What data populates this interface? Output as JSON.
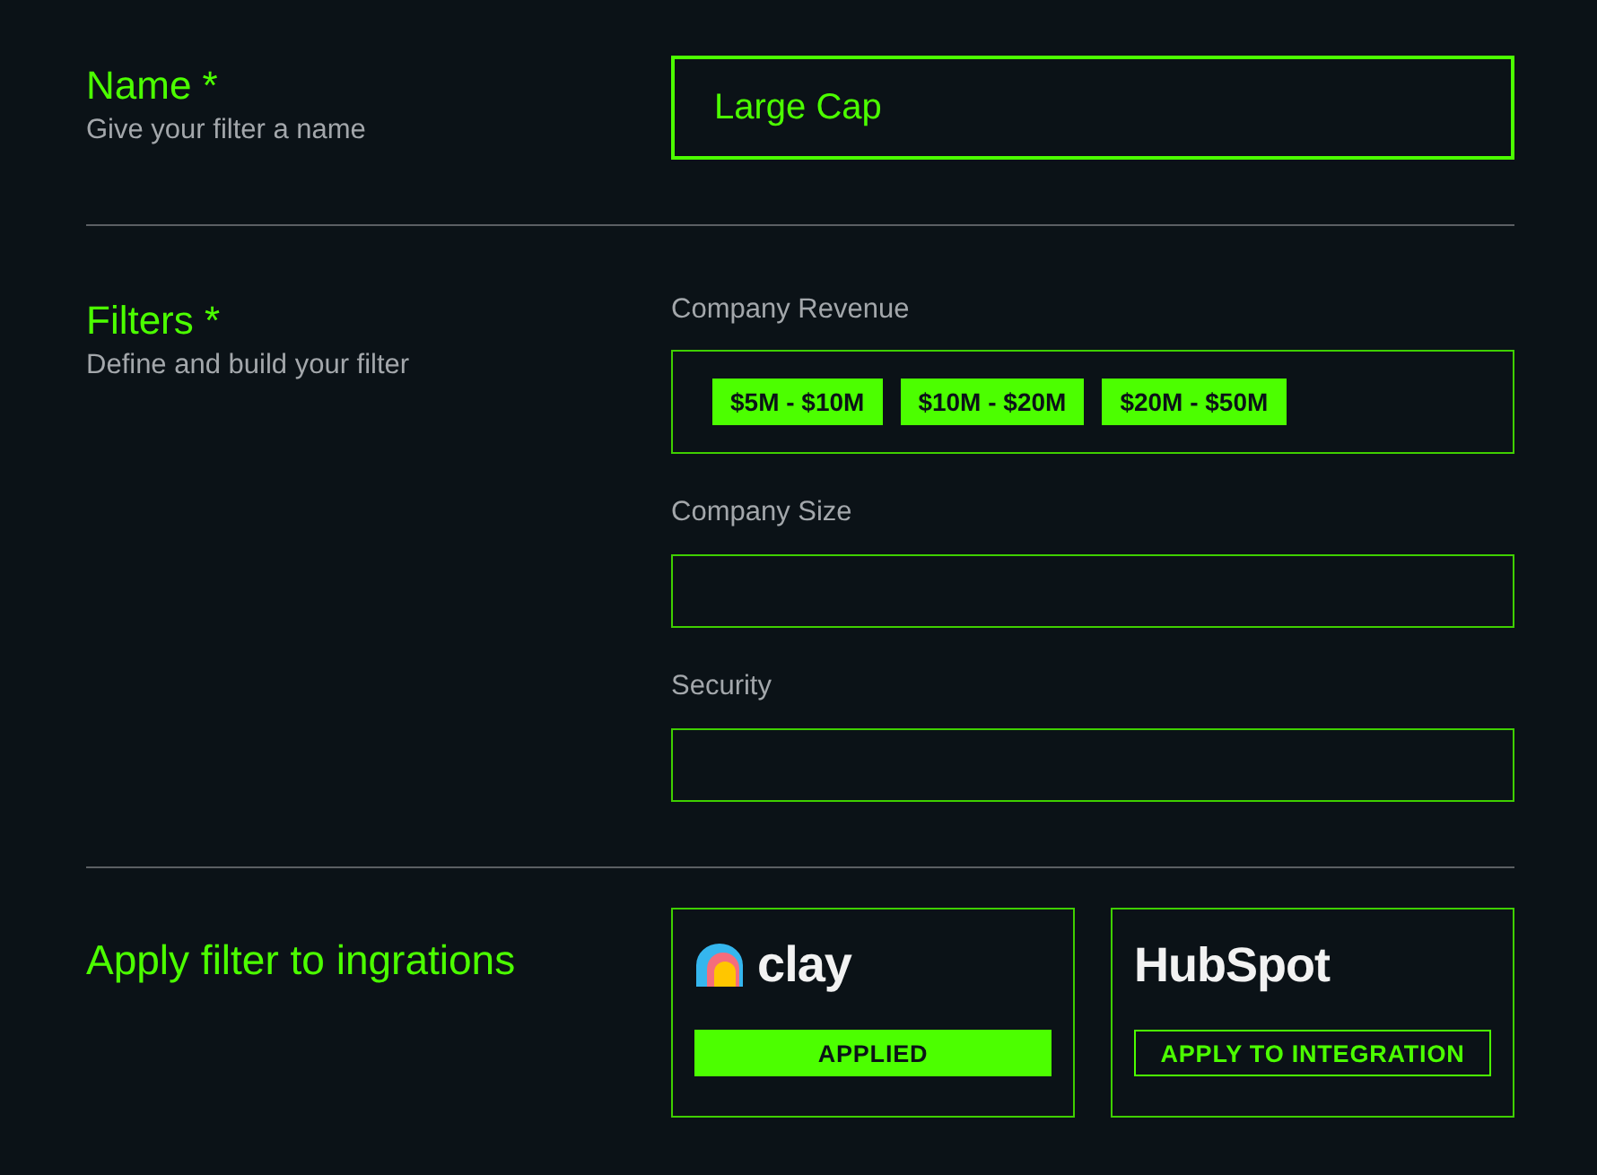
{
  "name_section": {
    "title": "Name *",
    "subtitle": "Give your filter a name",
    "value": "Large Cap"
  },
  "filters_section": {
    "title": "Filters *",
    "subtitle": "Define and build your filter",
    "fields": [
      {
        "label": "Company Revenue",
        "tags": [
          "$5M - $10M",
          "$10M - $20M",
          "$20M - $50M"
        ]
      },
      {
        "label": "Company Size"
      },
      {
        "label": "Security"
      }
    ]
  },
  "integrations_section": {
    "title": "Apply filter to ingrations",
    "integrations": [
      {
        "kind": "clay",
        "logo_text": "clay",
        "button": "APPLIED",
        "applied": true
      },
      {
        "kind": "hubspot",
        "logo_text": "HubSpot",
        "button": "APPLY TO INTEGRATION",
        "applied": false
      }
    ]
  }
}
